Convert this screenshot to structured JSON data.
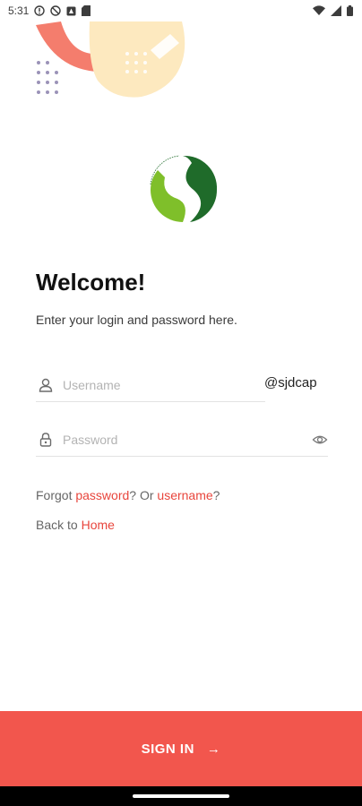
{
  "status_bar": {
    "time": "5:31"
  },
  "login": {
    "title": "Welcome!",
    "subtitle": "Enter your login and password here.",
    "username_placeholder": "Username",
    "domain_suffix": "@sjdcap",
    "password_placeholder": "Password",
    "forgot_prefix": "Forgot ",
    "forgot_password_link": "password",
    "forgot_middle": "? Or ",
    "forgot_username_link": "username",
    "forgot_suffix": "?",
    "back_prefix": "Back to ",
    "back_home_link": "Home",
    "signin_label": "SIGN IN",
    "signin_arrow": "→"
  },
  "colors": {
    "accent": "#f2564d",
    "link": "#e8453c",
    "logo_dark_green": "#1f6b2a",
    "logo_light_green": "#7fbf2a",
    "decor_salmon": "#f47d6d",
    "decor_cream": "#fde9bf",
    "decor_dots": "#9b93b8"
  },
  "icons": {
    "username_field": "user-icon",
    "password_field": "lock-icon",
    "password_toggle": "eye-icon",
    "signin_arrow": "arrow-right-icon"
  }
}
